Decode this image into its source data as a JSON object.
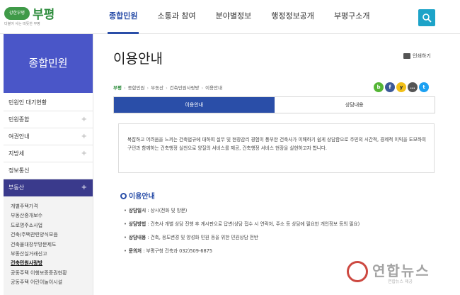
{
  "header": {
    "logo_badge": "강한부평",
    "logo_text": "부평",
    "logo_sub": "더불어 사는 따뜻한 부평",
    "nav": [
      "종합민원",
      "소통과 참여",
      "분야별정보",
      "행정정보공개",
      "부평구소개"
    ],
    "active_nav": "종합민원"
  },
  "sidebar": {
    "title": "종합민원",
    "items": [
      {
        "label": "민원인 대기현황",
        "plus": ""
      },
      {
        "label": "민원종합",
        "plus": "+"
      },
      {
        "label": "여권안내",
        "plus": "+"
      },
      {
        "label": "지방세",
        "plus": "+"
      },
      {
        "label": "정보통신",
        "plus": ""
      },
      {
        "label": "부동산",
        "plus": "+"
      }
    ],
    "sub_items": [
      "개별주택가격",
      "부동산중개보수",
      "도로명주소사업",
      "건축/주택관련양식모음",
      "건축물대장무방문제도",
      "부동산실거래신고",
      "건축민원사랑방",
      "공동주택 이행보증증권현황",
      "공동주택 어린이놀이시설"
    ],
    "current_sub": "건축민원사랑방"
  },
  "content": {
    "title": "이용안내",
    "print_label": "인쇄하기",
    "breadcrumb": [
      "부평",
      "종합민원",
      "부동산",
      "건축민원사랑방",
      "이용안내"
    ],
    "sns": [
      "b",
      "f",
      "y",
      "…",
      "t"
    ],
    "tabs": [
      "이용안내",
      "상담내용"
    ],
    "intro": "복잡하고 어려움을 느끼는 건축법규에 대하여 실무 및 현장감리 경험이 풍부한 건축사가 이해하기 쉽게 상담함으로 주민의 시간적, 경제적 이익을 도모하여 구민과 함께하는 건축행정 실천으로 양질의 서비스를 제공, 건축행정 서비스 현장을 실현하고자 합니다.",
    "section_title": "이용안내",
    "info": [
      {
        "label": "상담일시",
        "text": "상시(전화 및 방문)"
      },
      {
        "label": "상담방법",
        "text": "건축사 개별 상담 진행 후 게시판으로 답변(상담 접수 시 연락처, 주소 등 상담에 필요한 개인정보 등의 필요)"
      },
      {
        "label": "상담내용",
        "text": "건축, 용도변경 및 양성화 민원 등을 위한 민원상담 전반"
      },
      {
        "label": "문의처",
        "text": "부평구청 건축과 032)509-6875"
      }
    ]
  },
  "watermark": {
    "text": "연합뉴스",
    "sub": "연합뉴스 제공"
  },
  "colors": {
    "primary": "#2a4ea8",
    "side_title": "#4a56c8",
    "side_active": "#3a3a8c",
    "search": "#1da3c8"
  }
}
